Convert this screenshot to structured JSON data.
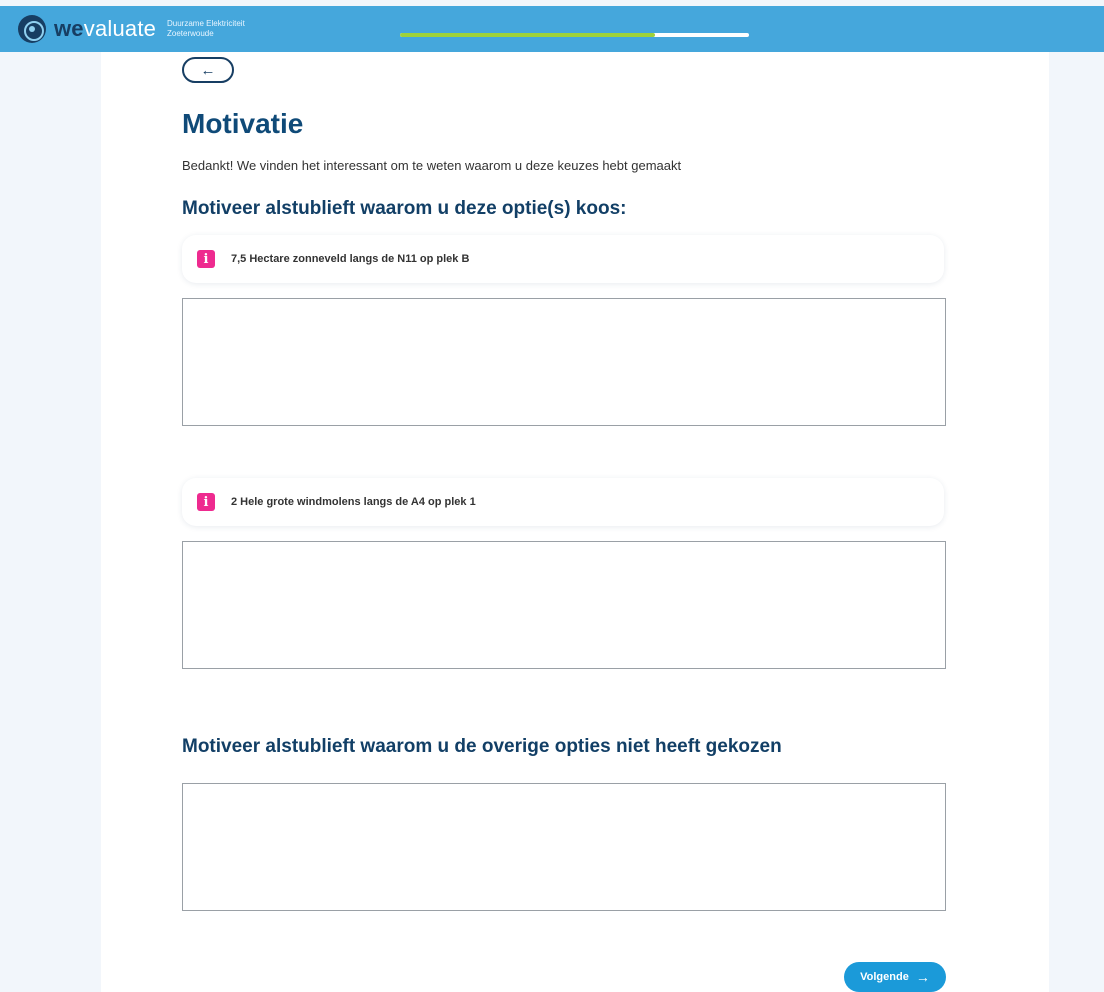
{
  "header": {
    "logo_bold": "we",
    "logo_light": "valuate",
    "project_line1": "Duurzame Elektriciteit",
    "project_line2": "Zoeterwoude",
    "progress_fraction": 0.73,
    "brand_color": "#45a7dc",
    "progress_color": "#9ed23a"
  },
  "back_button": {
    "icon": "arrow-left-icon",
    "glyph": "←"
  },
  "page": {
    "title": "Motivatie",
    "intro": "Bedankt! We vinden het interessant om te weten waarom u deze keuzes hebt gemaakt"
  },
  "section_chosen": {
    "title": "Motiveer alstublieft waarom u deze optie(s) koos:",
    "options": [
      {
        "icon": "info-icon",
        "glyph": "i",
        "label": "7,5 Hectare zonneveld langs de N11 op plek B",
        "value": ""
      },
      {
        "icon": "info-icon",
        "glyph": "i",
        "label": "2 Hele grote windmolens langs de A4 op plek 1",
        "value": ""
      }
    ]
  },
  "section_other": {
    "title": "Motiveer alstublieft waarom u de overige opties niet heeft gekozen",
    "value": ""
  },
  "next_button": {
    "label": "Volgende",
    "glyph": "→",
    "color": "#1b9ad9"
  }
}
